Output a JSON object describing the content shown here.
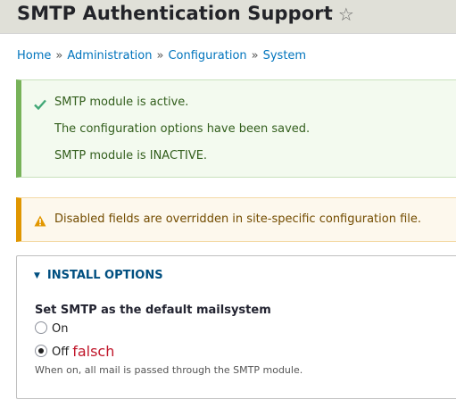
{
  "page": {
    "title": "SMTP Authentication Support",
    "favorite_icon": "star-outline-icon"
  },
  "breadcrumb": {
    "items": [
      "Home",
      "Administration",
      "Configuration",
      "System"
    ],
    "separator": "»"
  },
  "messages": {
    "status": {
      "icon": "check-icon",
      "lines": [
        "SMTP module is active.",
        "The configuration options have been saved.",
        "SMTP module is INACTIVE."
      ],
      "accent_color": "#77b259"
    },
    "warning": {
      "icon": "warning-icon",
      "text": "Disabled fields are overridden in site-specific configuration file.",
      "accent_color": "#e09600"
    }
  },
  "install_options": {
    "summary": "INSTALL OPTIONS",
    "expanded": true,
    "field_label": "Set SMTP as the default mailsystem",
    "options": [
      {
        "label": "On",
        "checked": false
      },
      {
        "label": "Off",
        "checked": true
      }
    ],
    "annotation": "falsch",
    "description": "When on, all mail is passed through the SMTP module."
  }
}
